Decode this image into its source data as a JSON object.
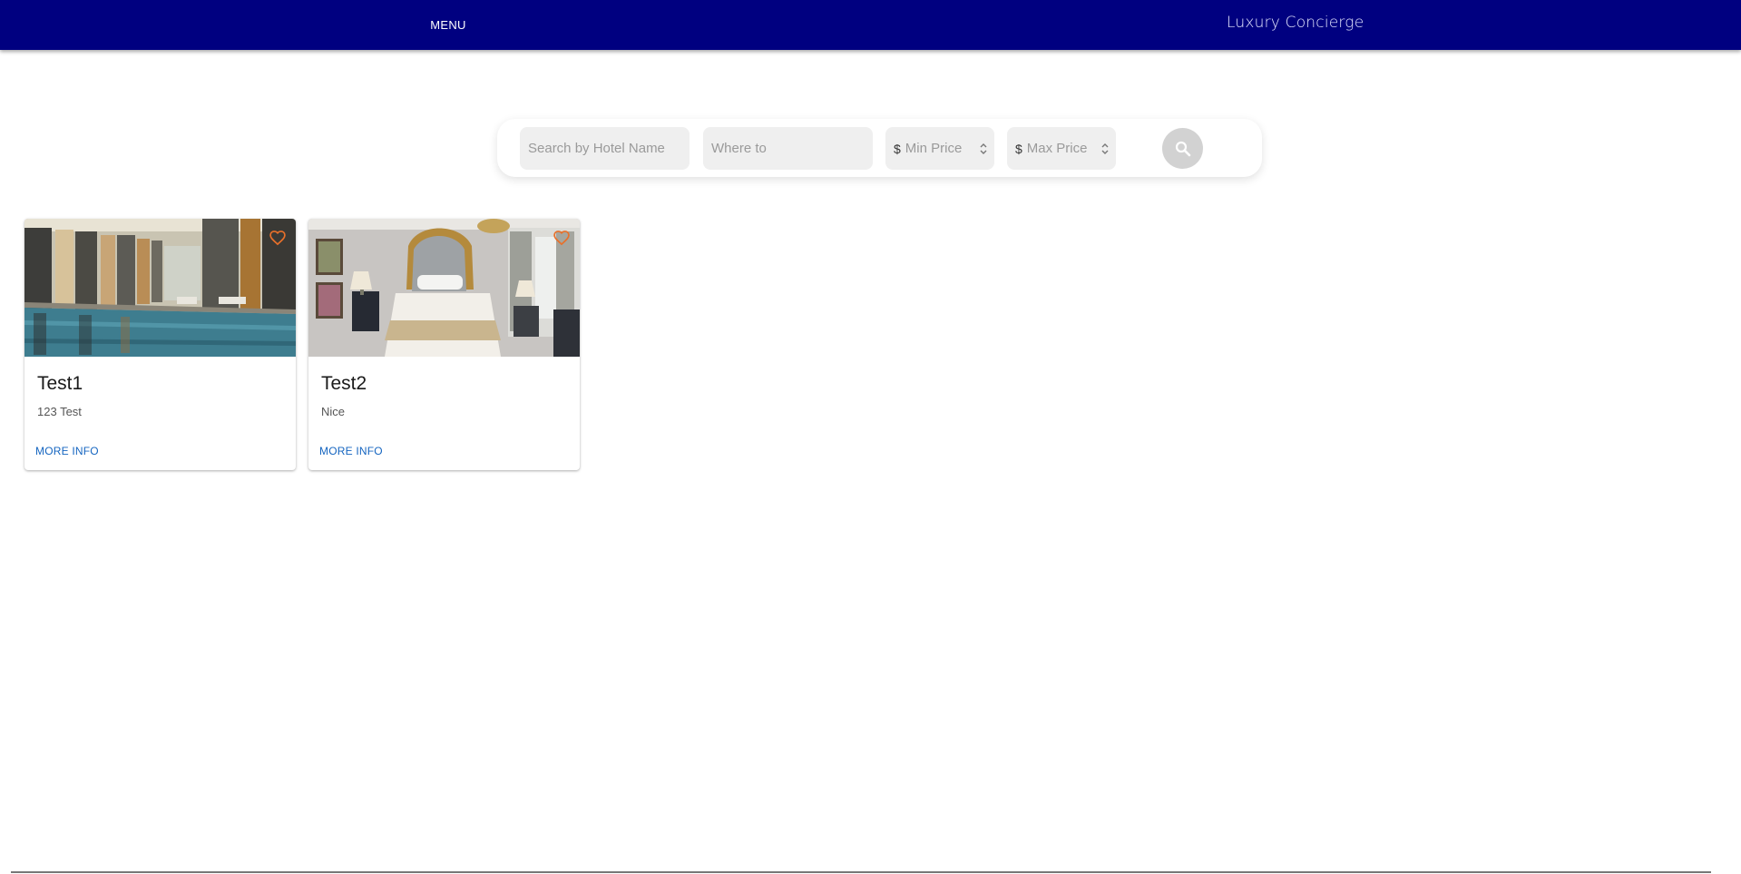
{
  "appbar": {
    "menu_label": "MENU",
    "brand": "Luxury Concierge",
    "background": "#000080"
  },
  "search": {
    "hotel_placeholder": "Search by Hotel Name",
    "where_placeholder": "Where to",
    "currency_symbol": "$",
    "min_price_placeholder": "Min Price",
    "max_price_placeholder": "Max Price",
    "button_icon": "search-icon"
  },
  "hotels": [
    {
      "title": "Test1",
      "description": "123 Test",
      "action": "MORE INFO",
      "image": "indoor-pool",
      "favorite_icon": "heart-outline-icon"
    },
    {
      "title": "Test2",
      "description": "Nice",
      "action": "MORE INFO",
      "image": "hotel-bedroom",
      "favorite_icon": "heart-outline-icon"
    }
  ],
  "colors": {
    "accent_link": "#1565c0",
    "favorite": "#e8702a"
  }
}
